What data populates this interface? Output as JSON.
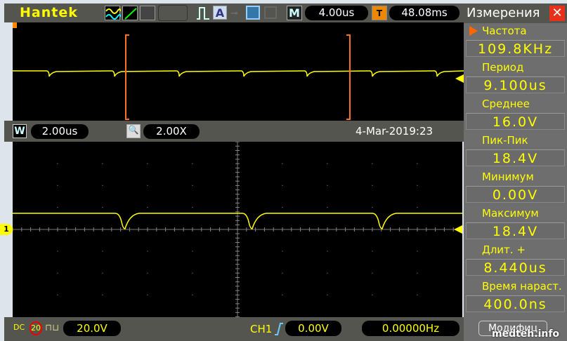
{
  "header": {
    "brand": "Hantek",
    "timebase": "4.00us",
    "trigger_time": "48.08ms",
    "m_label": "M",
    "t_label": "T"
  },
  "zoom_bar": {
    "w_label": "W",
    "window_timebase": "2.00us",
    "zoom_factor": "2.00X",
    "datetime": "4-Mar-2019:23"
  },
  "bottom": {
    "coupling": "DC",
    "bw_limit": "20",
    "volts_div": "20.0V",
    "trigger_source": "CH1",
    "trigger_level": "0.00V",
    "frequency": "0.00000Hz",
    "modify_button": "Модифиц",
    "watermark": "medteh.info"
  },
  "channel_marker": "1",
  "measurements": {
    "title": "Измерения",
    "items": [
      {
        "label": "Частота",
        "value": "109.8KHz"
      },
      {
        "label": "Период",
        "value": "9.100us"
      },
      {
        "label": "Среднее",
        "value": "16.0V"
      },
      {
        "label": "Пик-Пик",
        "value": "18.4V"
      },
      {
        "label": "Минимум",
        "value": "0.00V"
      },
      {
        "label": "Максимум",
        "value": "18.4V"
      },
      {
        "label": "Длит. +",
        "value": "8.440us"
      },
      {
        "label": "Время нараст.",
        "value": "400.0ns"
      }
    ]
  },
  "colors": {
    "trace": "#ffff00",
    "accent": "#ff6600",
    "panel": "#6e6e6e"
  }
}
